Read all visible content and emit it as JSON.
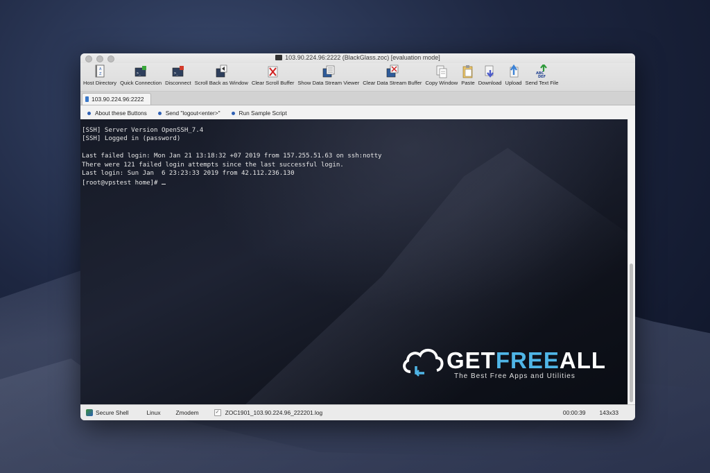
{
  "window": {
    "title": "103.90.224.96:2222 (BlackGlass.zoc) [evaluation mode]"
  },
  "toolbar": {
    "items": [
      {
        "label": "Host Directory",
        "icon": "address-book-icon"
      },
      {
        "label": "Quick Connection",
        "icon": "quick-connect-icon"
      },
      {
        "label": "Disconnect",
        "icon": "disconnect-icon"
      },
      {
        "label": "Scroll Back as Window",
        "icon": "scrollback-icon"
      },
      {
        "label": "Clear Scroll Buffer",
        "icon": "clear-buffer-icon"
      },
      {
        "label": "Show Data Stream Viewer",
        "icon": "data-stream-icon"
      },
      {
        "label": "Clear Data Stream Buffer",
        "icon": "clear-stream-icon"
      },
      {
        "label": "Copy Window",
        "icon": "copy-icon"
      },
      {
        "label": "Paste",
        "icon": "paste-icon"
      },
      {
        "label": "Download",
        "icon": "download-icon"
      },
      {
        "label": "Upload",
        "icon": "upload-icon"
      },
      {
        "label": "Send Text File",
        "icon": "send-text-icon"
      }
    ]
  },
  "tabs": [
    {
      "label": "103.90.224.96:2222"
    }
  ],
  "buttonbar": {
    "items": [
      {
        "label": "About these Buttons"
      },
      {
        "label": "Send \"logout<enter>\""
      },
      {
        "label": "Run Sample Script"
      }
    ]
  },
  "terminal": {
    "lines": [
      "[SSH] Server Version OpenSSH_7.4",
      "[SSH] Logged in (password)",
      "",
      "Last failed login: Mon Jan 21 13:18:32 +07 2019 from 157.255.51.63 on ssh:notty",
      "There were 121 failed login attempts since the last successful login.",
      "Last login: Sun Jan  6 23:23:33 2019 from 42.112.236.130",
      "[root@vpstest home]# "
    ]
  },
  "status": {
    "protocol": "Secure Shell",
    "emulation": "Linux",
    "transfer": "Zmodem",
    "logfile": "ZOC1901_103.90.224.96_222201.log",
    "timer": "00:00:39",
    "size": "143x33"
  },
  "watermark": {
    "brand_get": "GET",
    "brand_free": "FREE",
    "brand_all": "ALL",
    "tagline": "The Best Free Apps and Utilities"
  }
}
